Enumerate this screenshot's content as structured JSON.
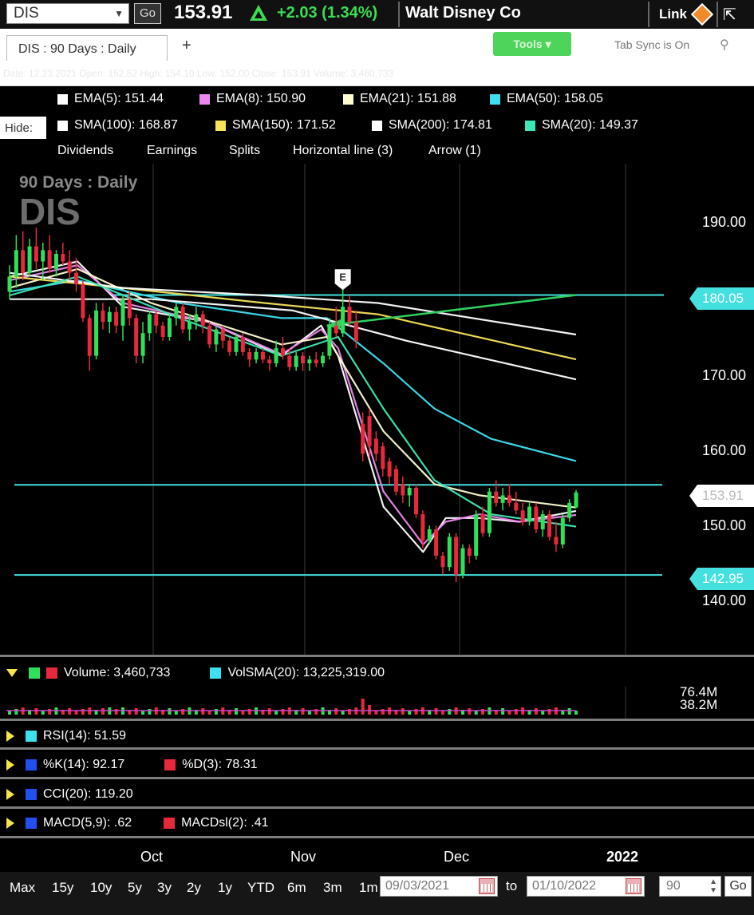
{
  "topbar": {
    "symbol": "DIS",
    "go_label": "Go",
    "price": "153.91",
    "change": "+2.03 (1.34%)",
    "company": "Walt Disney Co",
    "link_label": "Link"
  },
  "tabbar": {
    "tab_label": "DIS : 90  Days : Daily",
    "add_tab": "+",
    "tools_label": "Tools ▾",
    "tab_sync": "Tab Sync is On"
  },
  "infostrip": {
    "text": "Date: 12.23.2021   Open: 152.52   High: 154.10   Low: 152.00   Close: 153.91   Volume: 3,460,733"
  },
  "legend": {
    "row1": [
      {
        "label": "EMA(5): 151.44",
        "color": "#ffffff"
      },
      {
        "label": "EMA(8): 150.90",
        "color": "#ee88ee"
      },
      {
        "label": "EMA(21): 151.88",
        "color": "#fdfbd0"
      },
      {
        "label": "EMA(50): 158.05",
        "color": "#3ee0f0"
      }
    ],
    "hide_label": "Hide:",
    "row2": [
      {
        "label": "SMA(100): 168.87",
        "color": "#ffffff"
      },
      {
        "label": "SMA(150): 171.52",
        "color": "#f7e35a"
      },
      {
        "label": "SMA(200): 174.81",
        "color": "#ffffff"
      },
      {
        "label": "SMA(20): 149.37",
        "color": "#3ee8b6"
      }
    ],
    "events": [
      "Dividends",
      "Earnings",
      "Splits",
      "Horizontal line (3)",
      "Arrow (1)"
    ]
  },
  "chart": {
    "title": "90  Days : Daily",
    "symbol_watermark": "DIS",
    "earnings_marker": "E",
    "y_ticks": [
      "190.00",
      "170.00",
      "160.00",
      "150.00",
      "140.00"
    ],
    "tags": {
      "line1": "180.05",
      "price": "153.91",
      "line3": "142.95"
    },
    "x_labels": [
      "Oct",
      "Nov",
      "Dec",
      "2022"
    ]
  },
  "chart_data": {
    "type": "candlestick",
    "ylim": [
      138,
      193
    ],
    "y_ticks": [
      190,
      170,
      160,
      150,
      140
    ],
    "horizontal_lines": [
      180.05,
      154.9,
      142.95
    ],
    "ohlc": [
      [
        180.5,
        184.0,
        179.5,
        182.5
      ],
      [
        182.5,
        188.0,
        181.0,
        186.0
      ],
      [
        186.0,
        188.5,
        182.0,
        183.0
      ],
      [
        183.0,
        187.5,
        182.5,
        186.5
      ],
      [
        186.5,
        189.0,
        183.5,
        184.5
      ],
      [
        184.5,
        187.0,
        182.0,
        186.0
      ],
      [
        186.0,
        188.0,
        183.0,
        183.5
      ],
      [
        183.5,
        186.0,
        182.5,
        185.5
      ],
      [
        185.5,
        187.0,
        184.0,
        184.5
      ],
      [
        184.5,
        186.0,
        182.0,
        183.0
      ],
      [
        183.0,
        185.0,
        180.5,
        181.5
      ],
      [
        181.5,
        182.0,
        176.5,
        177.0
      ],
      [
        177.0,
        177.5,
        170.0,
        172.0
      ],
      [
        172.0,
        179.0,
        171.5,
        178.0
      ],
      [
        178.0,
        179.0,
        175.5,
        176.5
      ],
      [
        176.5,
        178.5,
        175.0,
        177.8
      ],
      [
        177.8,
        178.5,
        175.0,
        176.0
      ],
      [
        176.0,
        180.0,
        174.0,
        179.5
      ],
      [
        179.5,
        180.5,
        176.0,
        177.0
      ],
      [
        177.0,
        177.5,
        171.0,
        172.0
      ],
      [
        172.0,
        176.5,
        171.0,
        175.0
      ],
      [
        175.0,
        178.0,
        174.0,
        177.5
      ],
      [
        177.5,
        178.0,
        175.0,
        176.0
      ],
      [
        176.0,
        176.5,
        174.0,
        174.5
      ],
      [
        174.5,
        177.5,
        174.0,
        177.0
      ],
      [
        177.0,
        179.0,
        176.0,
        178.5
      ],
      [
        178.5,
        179.0,
        175.0,
        175.5
      ],
      [
        175.5,
        177.5,
        174.0,
        176.5
      ],
      [
        176.5,
        178.5,
        175.5,
        177.5
      ],
      [
        177.5,
        178.0,
        175.0,
        176.0
      ],
      [
        176.0,
        176.5,
        173.0,
        173.5
      ],
      [
        173.5,
        176.0,
        172.5,
        175.5
      ],
      [
        175.5,
        176.0,
        173.0,
        174.0
      ],
      [
        174.0,
        174.5,
        172.0,
        172.5
      ],
      [
        172.5,
        175.0,
        172.0,
        174.5
      ],
      [
        174.5,
        175.0,
        172.0,
        172.5
      ],
      [
        172.5,
        173.0,
        170.5,
        171.5
      ],
      [
        171.5,
        173.0,
        171.0,
        172.5
      ],
      [
        172.5,
        173.0,
        171.0,
        171.5
      ],
      [
        171.5,
        172.0,
        170.0,
        171.0
      ],
      [
        171.0,
        174.0,
        170.5,
        173.0
      ],
      [
        173.0,
        174.5,
        171.5,
        172.0
      ],
      [
        172.0,
        173.0,
        170.0,
        170.5
      ],
      [
        170.5,
        172.5,
        170.0,
        172.0
      ],
      [
        172.0,
        172.5,
        170.0,
        171.0
      ],
      [
        171.0,
        172.0,
        170.0,
        171.5
      ],
      [
        171.5,
        172.5,
        170.5,
        171.0
      ],
      [
        171.0,
        172.5,
        170.5,
        172.0
      ],
      [
        172.0,
        177.0,
        171.5,
        176.0
      ],
      [
        176.0,
        178.5,
        174.5,
        175.0
      ],
      [
        175.0,
        181.0,
        174.5,
        178.5
      ],
      [
        178.5,
        180.0,
        176.0,
        176.5
      ],
      [
        176.5,
        178.0,
        173.0,
        174.0
      ],
      [
        163.0,
        164.5,
        158.0,
        159.0
      ],
      [
        164.0,
        165.0,
        158.5,
        160.0
      ],
      [
        161.0,
        162.0,
        158.0,
        159.0
      ],
      [
        160.0,
        160.5,
        156.0,
        157.0
      ],
      [
        158.0,
        158.5,
        155.0,
        156.0
      ],
      [
        157.0,
        157.5,
        153.5,
        154.0
      ],
      [
        155.0,
        156.0,
        152.5,
        153.5
      ],
      [
        153.5,
        155.0,
        152.0,
        154.5
      ],
      [
        154.5,
        155.0,
        150.5,
        151.0
      ],
      [
        151.0,
        151.5,
        146.5,
        147.5
      ],
      [
        147.5,
        149.5,
        147.0,
        149.0
      ],
      [
        149.0,
        149.5,
        145.0,
        145.5
      ],
      [
        145.5,
        146.0,
        143.0,
        144.0
      ],
      [
        144.0,
        148.5,
        143.5,
        148.0
      ],
      [
        148.0,
        148.5,
        142.0,
        143.0
      ],
      [
        143.0,
        147.0,
        142.5,
        146.5
      ],
      [
        146.5,
        147.0,
        144.5,
        145.5
      ],
      [
        145.5,
        151.5,
        145.0,
        151.0
      ],
      [
        151.0,
        152.0,
        148.0,
        148.5
      ],
      [
        148.5,
        154.5,
        148.0,
        154.0
      ],
      [
        154.0,
        155.5,
        152.0,
        152.5
      ],
      [
        152.5,
        154.5,
        151.5,
        153.5
      ],
      [
        153.5,
        155.0,
        152.0,
        152.5
      ],
      [
        152.5,
        154.0,
        151.0,
        151.5
      ],
      [
        151.5,
        152.5,
        149.5,
        150.0
      ],
      [
        150.0,
        152.5,
        149.5,
        152.0
      ],
      [
        152.0,
        152.5,
        148.5,
        149.0
      ],
      [
        149.0,
        151.5,
        148.0,
        151.0
      ],
      [
        151.0,
        151.5,
        147.5,
        148.0
      ],
      [
        148.0,
        150.0,
        146.0,
        147.0
      ],
      [
        147.0,
        151.0,
        146.5,
        150.5
      ],
      [
        150.5,
        153.0,
        150.0,
        152.5
      ],
      [
        151.9,
        154.2,
        151.8,
        153.9
      ]
    ],
    "series": [
      {
        "name": "EMA(5)",
        "color": "#ffffff",
        "values": [
          [
            0,
            182.5
          ],
          [
            0.12,
            184.5
          ],
          [
            0.2,
            178.5
          ],
          [
            0.35,
            176.5
          ],
          [
            0.48,
            172.0
          ],
          [
            0.55,
            176.0
          ],
          [
            0.58,
            172.0
          ],
          [
            0.66,
            152.0
          ],
          [
            0.73,
            146.0
          ],
          [
            0.77,
            150.5
          ],
          [
            0.83,
            150.5
          ],
          [
            0.9,
            150.0
          ],
          [
            1,
            151.44
          ]
        ]
      },
      {
        "name": "EMA(8)",
        "color": "#ee88ee",
        "values": [
          [
            0,
            182.0
          ],
          [
            0.12,
            184.0
          ],
          [
            0.2,
            179.0
          ],
          [
            0.35,
            176.5
          ],
          [
            0.48,
            172.2
          ],
          [
            0.55,
            175.5
          ],
          [
            0.58,
            173.0
          ],
          [
            0.66,
            154.0
          ],
          [
            0.73,
            147.0
          ],
          [
            0.77,
            150.0
          ],
          [
            0.83,
            151.0
          ],
          [
            0.9,
            150.0
          ],
          [
            1,
            150.9
          ]
        ]
      },
      {
        "name": "EMA(21)",
        "color": "#fdfbd0",
        "values": [
          [
            0,
            181.0
          ],
          [
            0.12,
            183.5
          ],
          [
            0.25,
            179.0
          ],
          [
            0.48,
            173.5
          ],
          [
            0.56,
            174.5
          ],
          [
            0.66,
            162.0
          ],
          [
            0.75,
            155.0
          ],
          [
            0.83,
            153.5
          ],
          [
            1,
            151.88
          ]
        ]
      },
      {
        "name": "EMA(50)",
        "color": "#3ee0f0",
        "values": [
          [
            0,
            180.5
          ],
          [
            0.12,
            182.0
          ],
          [
            0.3,
            179.0
          ],
          [
            0.48,
            177.0
          ],
          [
            0.56,
            177.0
          ],
          [
            0.66,
            171.0
          ],
          [
            0.75,
            165.0
          ],
          [
            0.85,
            161.0
          ],
          [
            1,
            158.05
          ]
        ]
      },
      {
        "name": "SMA(100)",
        "color": "#ffffff",
        "values": [
          [
            0,
            179.5
          ],
          [
            0.25,
            179.5
          ],
          [
            0.5,
            178.0
          ],
          [
            0.7,
            174.0
          ],
          [
            1,
            168.87
          ]
        ]
      },
      {
        "name": "SMA(150)",
        "color": "#f7e35a",
        "values": [
          [
            0,
            182.5
          ],
          [
            0.2,
            181.0
          ],
          [
            0.45,
            179.0
          ],
          [
            0.65,
            177.5
          ],
          [
            1,
            171.52
          ]
        ]
      },
      {
        "name": "SMA(200)",
        "color": "#ffffff",
        "values": [
          [
            0,
            183.0
          ],
          [
            0.2,
            181.0
          ],
          [
            0.45,
            180.0
          ],
          [
            0.65,
            179.0
          ],
          [
            1,
            174.81
          ]
        ]
      },
      {
        "name": "SMA(20)",
        "color": "#3ee8b6",
        "values": [
          [
            0,
            180.0
          ],
          [
            0.12,
            182.5
          ],
          [
            0.3,
            177.0
          ],
          [
            0.48,
            172.0
          ],
          [
            0.58,
            174.5
          ],
          [
            0.66,
            165.0
          ],
          [
            0.75,
            155.5
          ],
          [
            0.85,
            151.0
          ],
          [
            1,
            149.37
          ]
        ]
      }
    ],
    "arrow_annotation": {
      "from": [
        0.56,
        176.0
      ],
      "to": [
        1.0,
        180.05
      ],
      "color": "#30d060"
    },
    "x_labels": [
      "Oct",
      "Nov",
      "Dec",
      "2022"
    ]
  },
  "indicators": {
    "volume": {
      "label": "Volume: 3,460,733",
      "vol_sma": "VolSMA(20): 13,225,319.00",
      "scale_hi": "76.4M",
      "scale_lo": "38.2M"
    },
    "rsi": {
      "label": "RSI(14): 51.59"
    },
    "stoch": {
      "k": "%K(14): 92.17",
      "d": "%D(3): 78.31"
    },
    "cci": {
      "label": "CCI(20): 119.20"
    },
    "macd": {
      "macd": "MACD(5,9): .62",
      "signal": "MACDsl(2): .41"
    }
  },
  "bottombar": {
    "ranges": [
      "Max",
      "15y",
      "10y",
      "5y",
      "3y",
      "2y",
      "1y",
      "YTD",
      "6m",
      "3m",
      "1m"
    ],
    "from_date": "09/03/2021",
    "to_label": "to",
    "to_date": "01/10/2022",
    "days": "90",
    "go_label": "Go"
  },
  "colors": {
    "up_candle": "#2ee05a",
    "down_candle": "#e8283c",
    "hline": "#44e0e0",
    "accent_green": "#3ddc52"
  }
}
